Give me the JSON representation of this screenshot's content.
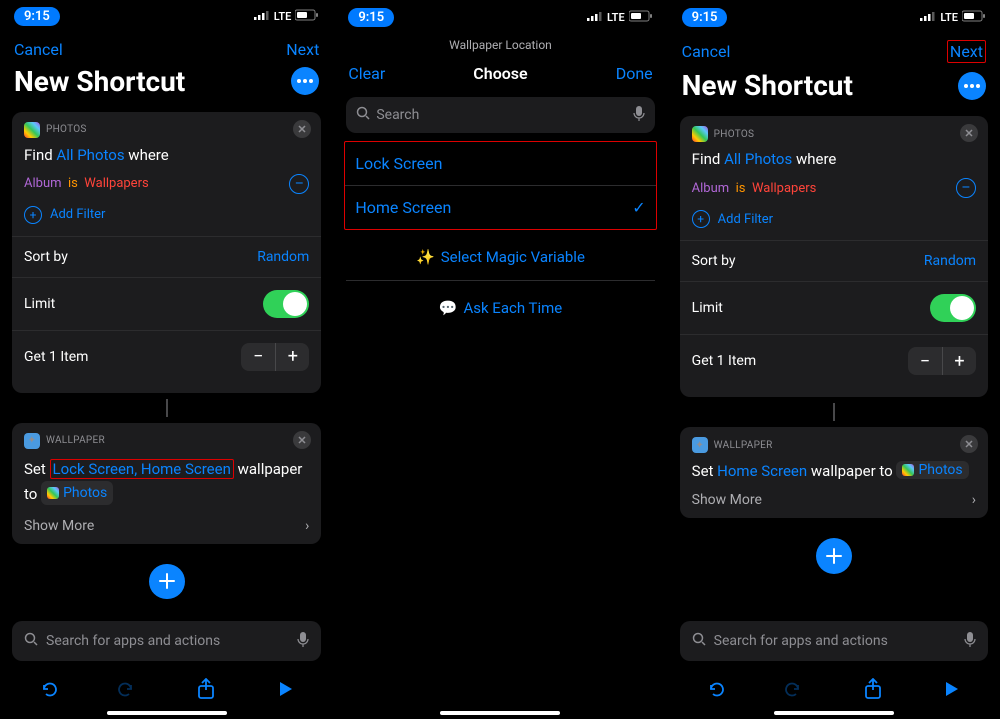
{
  "status": {
    "time": "9:15",
    "net": "LTE"
  },
  "screen1": {
    "nav": {
      "cancel": "Cancel",
      "next": "Next"
    },
    "title": "New Shortcut",
    "photosCard": {
      "appLabel": "PHOTOS",
      "find": "Find",
      "allPhotos": "All Photos",
      "where": "where",
      "album": "Album",
      "is": "is",
      "wallpapers": "Wallpapers",
      "addFilter": "Add Filter",
      "sortBy": "Sort by",
      "sortValue": "Random",
      "limit": "Limit",
      "getItem": "Get 1 Item"
    },
    "wallpaperCard": {
      "appLabel": "WALLPAPER",
      "set": "Set",
      "locations": "Lock Screen, Home Screen",
      "wallpaper": "wallpaper",
      "to": "to",
      "photosToken": "Photos",
      "showMore": "Show More"
    },
    "searchPlaceholder": "Search for apps and actions"
  },
  "screen2": {
    "subhead": "Wallpaper Location",
    "clear": "Clear",
    "choose": "Choose",
    "done": "Done",
    "searchPlaceholder": "Search",
    "options": {
      "lock": "Lock Screen",
      "home": "Home Screen"
    },
    "magic": "Select Magic Variable",
    "ask": "Ask Each Time"
  },
  "screen3": {
    "nav": {
      "cancel": "Cancel",
      "next": "Next"
    },
    "title": "New Shortcut",
    "photosCard": {
      "appLabel": "PHOTOS",
      "find": "Find",
      "allPhotos": "All Photos",
      "where": "where",
      "album": "Album",
      "is": "is",
      "wallpapers": "Wallpapers",
      "addFilter": "Add Filter",
      "sortBy": "Sort by",
      "sortValue": "Random",
      "limit": "Limit",
      "getItem": "Get 1 Item"
    },
    "wallpaperCard": {
      "appLabel": "WALLPAPER",
      "set": "Set",
      "location": "Home Screen",
      "wallpaperTo": "wallpaper to",
      "photosToken": "Photos",
      "showMore": "Show More"
    },
    "searchPlaceholder": "Search for apps and actions"
  }
}
